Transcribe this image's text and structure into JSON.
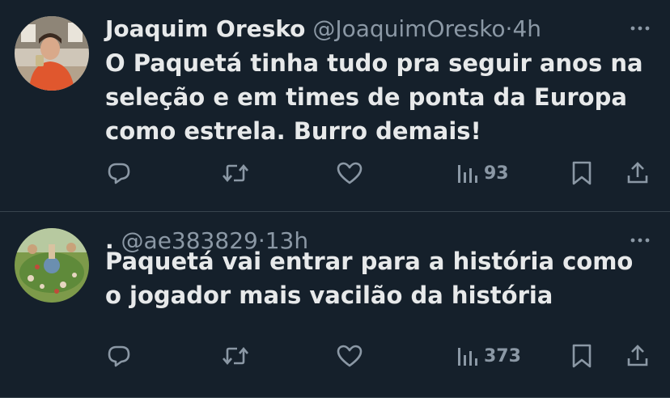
{
  "tweets": [
    {
      "author_name": "Joaquim Oresko",
      "handle": "@JoaquimOresko",
      "separator": "·",
      "time": "4h",
      "text": "O Paquetá tinha tudo pra seguir anos na seleção e em times de ponta da Europa como estrela. Burro demais!",
      "views": "93",
      "avatar_icon": "person-photo-avatar"
    },
    {
      "author_name": ".",
      "handle": "@ae383829",
      "separator": "·",
      "time": "13h",
      "text": "Paquetá vai entrar para a história como o jogador mais vacilão da história",
      "views": "373",
      "avatar_icon": "painting-avatar"
    }
  ],
  "colors": {
    "background": "#15202b",
    "text": "#e7e9ea",
    "secondary": "#8b98a5",
    "divider": "#38444d"
  }
}
